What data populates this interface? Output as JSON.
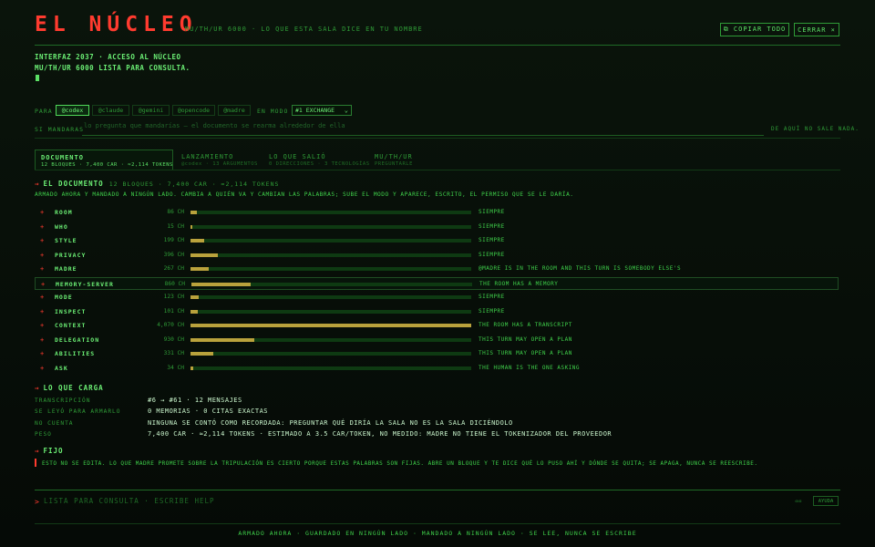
{
  "header": {
    "title": "EL NÚCLEO",
    "subtitle": "MU/TH/UR 6000 · LO QUE ESTA SALA DICE EN TU NOMBRE",
    "copy_button": "⧉ COPIAR TODO",
    "close_button": "CERRAR ×"
  },
  "intro": {
    "line1": "INTERFAZ 2037 · ACCESO AL NÚCLEO",
    "line2": "MU/TH/UR 6000 LISTA PARA CONSULTA."
  },
  "para": {
    "label": "PARA",
    "chips": [
      "@codex",
      "@claude",
      "@gemini",
      "@opencode",
      "@madre"
    ],
    "modo_label": "EN MODO",
    "mode_value": "#1 EXCHANGE"
  },
  "mandar": {
    "label": "SI MANDARAS",
    "placeholder": "lo pregunta que mandarías — el documento se rearma alrededor de ella",
    "nosale": "DE AQUÍ NO SALE NADA."
  },
  "tabs": [
    {
      "title": "DOCUMENTO",
      "sub": "12 BLOQUES · 7,400 CAR · ≈2,114 TOKENS"
    },
    {
      "title": "LANZAMIENTO",
      "sub": "@codex · 13 ARGUMENTOS"
    },
    {
      "title": "LO QUE SALIÓ",
      "sub": "0 DIRECCIONES · 3 TECNOLOGÍAS"
    },
    {
      "title": "MU/TH/UR",
      "sub": "PREGUNTARLE"
    }
  ],
  "documento": {
    "heading": "EL DOCUMENTO",
    "meta": "12 BLOQUES · 7,400 CAR · ≈2,114 TOKENS",
    "desc": "ARMADO AHORA Y MANDADO A NINGÚN LADO. CAMBIA A QUIÉN VA Y CAMBIAN LAS PALABRAS; SUBE EL MODO Y APARECE, ESCRITO, EL PERMISO QUE SE LE DARÍA.",
    "rows": [
      {
        "name": "ROOM",
        "size": "86 CH",
        "value": 86,
        "note": "SIEMPRE"
      },
      {
        "name": "WHO",
        "size": "15 CH",
        "value": 15,
        "note": "SIEMPRE"
      },
      {
        "name": "STYLE",
        "size": "199 CH",
        "value": 199,
        "note": "SIEMPRE"
      },
      {
        "name": "PRIVACY",
        "size": "396 CH",
        "value": 396,
        "note": "SIEMPRE"
      },
      {
        "name": "MADRE",
        "size": "267 CH",
        "value": 267,
        "note": "@MADRE IS IN THE ROOM AND THIS TURN IS SOMEBODY ELSE'S"
      },
      {
        "name": "MEMORY-SERVER",
        "size": "860 CH",
        "value": 860,
        "note": "THE ROOM HAS A MEMORY"
      },
      {
        "name": "MODE",
        "size": "123 CH",
        "value": 123,
        "note": "SIEMPRE"
      },
      {
        "name": "INSPECT",
        "size": "101 CH",
        "value": 101,
        "note": "SIEMPRE"
      },
      {
        "name": "CONTEXT",
        "size": "4,070 CH",
        "value": 4070,
        "note": "THE ROOM HAS A TRANSCRIPT"
      },
      {
        "name": "DELEGATION",
        "size": "930 CH",
        "value": 930,
        "note": "THIS TURN MAY OPEN A PLAN"
      },
      {
        "name": "ABILITIES",
        "size": "331 CH",
        "value": 331,
        "note": "THIS TURN MAY OPEN A PLAN"
      },
      {
        "name": "ASK",
        "size": "34 CH",
        "value": 34,
        "note": "THE HUMAN IS THE ONE ASKING"
      }
    ]
  },
  "carga": {
    "heading": "LO QUE CARGA",
    "items": [
      {
        "key": "TRANSCRIPCIÓN",
        "value": "#6 → #61 · 12 MENSAJES"
      },
      {
        "key": "SE LEYÓ PARA ARMARLO",
        "value": "0 MEMORIAS · 0 CITAS EXACTAS"
      },
      {
        "key": "NO CUENTA",
        "value": "NINGUNA SE CONTÓ COMO RECORDADA: PREGUNTAR QUÉ DIRÍA LA SALA NO ES LA SALA DICIÉNDOLO"
      },
      {
        "key": "PESO",
        "value": "7,400 CAR · ≈2,114 TOKENS · ESTIMADO A 3.5 CAR/TOKEN, NO MEDIDO: MADRE NO TIENE EL TOKENIZADOR DEL PROVEEDOR"
      }
    ]
  },
  "fijo": {
    "heading": "FIJO",
    "text": "ESTO NO SE EDITA. LO QUE MADRE PROMETE SOBRE LA TRIPULACIÓN ES CIERTO PORQUE ESTAS PALABRAS SON FIJAS. ABRE UN BLOQUE Y TE DICE QUÉ LO PUSO AHÍ Y DÓNDE SE QUITA; SE APAGA, NUNCA SE REESCRIBE."
  },
  "prompt": {
    "arrow": ">",
    "placeholder": "LISTA PARA CONSULTA · ESCRIBE HELP",
    "hint": "⌫⌫",
    "ayuda": "AYUDA"
  },
  "footer": "ARMADO AHORA · GUARDADO EN NINGÚN LADO · MANDADO A NINGÚN LADO · SE LEE, NUNCA SE ESCRIBE",
  "colors": {
    "accent": "#ff3b2f",
    "terminal_green": "#3fcf4a",
    "bar_fill": "#b9a23c"
  }
}
